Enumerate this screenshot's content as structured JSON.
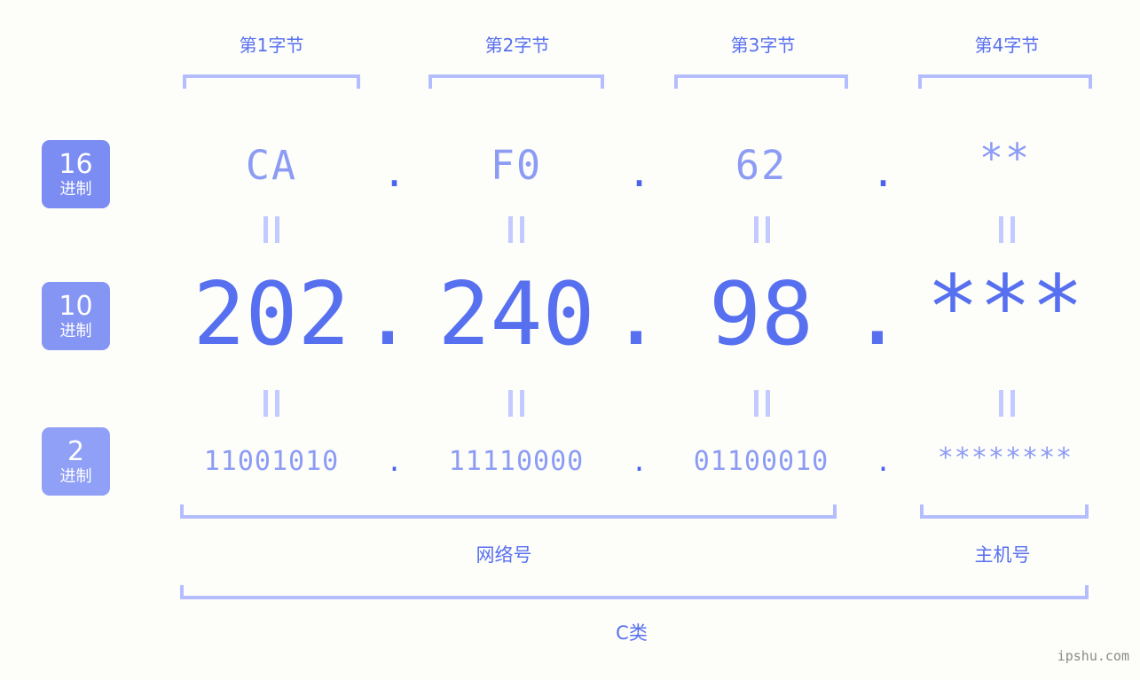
{
  "background_color": "#fdfdfa",
  "accent_colors": {
    "primary_text": "#5770f0",
    "secondary_text": "#8c9cf5",
    "bracket": "#b4beff",
    "badge_hex": "#7b8cf2",
    "badge_dec": "#8595f4",
    "badge_bin": "#8fa0f6"
  },
  "byte_headers": [
    {
      "label": "第1字节"
    },
    {
      "label": "第2字节"
    },
    {
      "label": "第3字节"
    },
    {
      "label": "第4字节"
    }
  ],
  "rows": [
    {
      "id": "hex",
      "badge_number": "16",
      "badge_suffix": "进制",
      "values": [
        "CA",
        "F0",
        "62",
        "**"
      ],
      "separator": "."
    },
    {
      "id": "dec",
      "badge_number": "10",
      "badge_suffix": "进制",
      "values": [
        "202",
        "240",
        "98",
        "***"
      ],
      "separator": "."
    },
    {
      "id": "bin",
      "badge_number": "2",
      "badge_suffix": "进制",
      "values": [
        "11001010",
        "11110000",
        "01100010",
        "********"
      ],
      "separator": "."
    }
  ],
  "equal_connector": "‖",
  "sections": [
    {
      "id": "network",
      "label": "网络号"
    },
    {
      "id": "host",
      "label": "主机号"
    }
  ],
  "class_label": "C类",
  "watermark": "ipshu.com"
}
